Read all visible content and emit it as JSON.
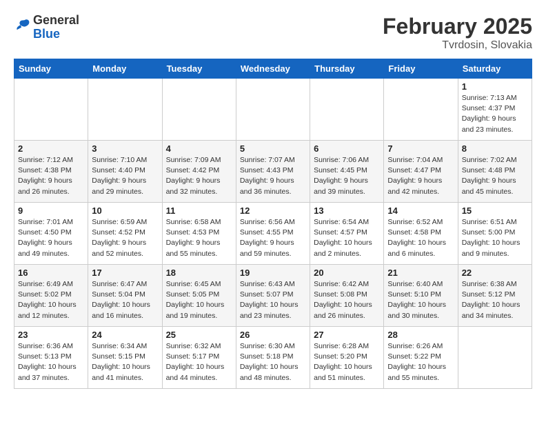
{
  "header": {
    "logo_general": "General",
    "logo_blue": "Blue",
    "month_title": "February 2025",
    "location": "Tvrdosin, Slovakia"
  },
  "days_of_week": [
    "Sunday",
    "Monday",
    "Tuesday",
    "Wednesday",
    "Thursday",
    "Friday",
    "Saturday"
  ],
  "weeks": [
    [
      {
        "day": "",
        "info": ""
      },
      {
        "day": "",
        "info": ""
      },
      {
        "day": "",
        "info": ""
      },
      {
        "day": "",
        "info": ""
      },
      {
        "day": "",
        "info": ""
      },
      {
        "day": "",
        "info": ""
      },
      {
        "day": "1",
        "info": "Sunrise: 7:13 AM\nSunset: 4:37 PM\nDaylight: 9 hours and 23 minutes."
      }
    ],
    [
      {
        "day": "2",
        "info": "Sunrise: 7:12 AM\nSunset: 4:38 PM\nDaylight: 9 hours and 26 minutes."
      },
      {
        "day": "3",
        "info": "Sunrise: 7:10 AM\nSunset: 4:40 PM\nDaylight: 9 hours and 29 minutes."
      },
      {
        "day": "4",
        "info": "Sunrise: 7:09 AM\nSunset: 4:42 PM\nDaylight: 9 hours and 32 minutes."
      },
      {
        "day": "5",
        "info": "Sunrise: 7:07 AM\nSunset: 4:43 PM\nDaylight: 9 hours and 36 minutes."
      },
      {
        "day": "6",
        "info": "Sunrise: 7:06 AM\nSunset: 4:45 PM\nDaylight: 9 hours and 39 minutes."
      },
      {
        "day": "7",
        "info": "Sunrise: 7:04 AM\nSunset: 4:47 PM\nDaylight: 9 hours and 42 minutes."
      },
      {
        "day": "8",
        "info": "Sunrise: 7:02 AM\nSunset: 4:48 PM\nDaylight: 9 hours and 45 minutes."
      }
    ],
    [
      {
        "day": "9",
        "info": "Sunrise: 7:01 AM\nSunset: 4:50 PM\nDaylight: 9 hours and 49 minutes."
      },
      {
        "day": "10",
        "info": "Sunrise: 6:59 AM\nSunset: 4:52 PM\nDaylight: 9 hours and 52 minutes."
      },
      {
        "day": "11",
        "info": "Sunrise: 6:58 AM\nSunset: 4:53 PM\nDaylight: 9 hours and 55 minutes."
      },
      {
        "day": "12",
        "info": "Sunrise: 6:56 AM\nSunset: 4:55 PM\nDaylight: 9 hours and 59 minutes."
      },
      {
        "day": "13",
        "info": "Sunrise: 6:54 AM\nSunset: 4:57 PM\nDaylight: 10 hours and 2 minutes."
      },
      {
        "day": "14",
        "info": "Sunrise: 6:52 AM\nSunset: 4:58 PM\nDaylight: 10 hours and 6 minutes."
      },
      {
        "day": "15",
        "info": "Sunrise: 6:51 AM\nSunset: 5:00 PM\nDaylight: 10 hours and 9 minutes."
      }
    ],
    [
      {
        "day": "16",
        "info": "Sunrise: 6:49 AM\nSunset: 5:02 PM\nDaylight: 10 hours and 12 minutes."
      },
      {
        "day": "17",
        "info": "Sunrise: 6:47 AM\nSunset: 5:04 PM\nDaylight: 10 hours and 16 minutes."
      },
      {
        "day": "18",
        "info": "Sunrise: 6:45 AM\nSunset: 5:05 PM\nDaylight: 10 hours and 19 minutes."
      },
      {
        "day": "19",
        "info": "Sunrise: 6:43 AM\nSunset: 5:07 PM\nDaylight: 10 hours and 23 minutes."
      },
      {
        "day": "20",
        "info": "Sunrise: 6:42 AM\nSunset: 5:08 PM\nDaylight: 10 hours and 26 minutes."
      },
      {
        "day": "21",
        "info": "Sunrise: 6:40 AM\nSunset: 5:10 PM\nDaylight: 10 hours and 30 minutes."
      },
      {
        "day": "22",
        "info": "Sunrise: 6:38 AM\nSunset: 5:12 PM\nDaylight: 10 hours and 34 minutes."
      }
    ],
    [
      {
        "day": "23",
        "info": "Sunrise: 6:36 AM\nSunset: 5:13 PM\nDaylight: 10 hours and 37 minutes."
      },
      {
        "day": "24",
        "info": "Sunrise: 6:34 AM\nSunset: 5:15 PM\nDaylight: 10 hours and 41 minutes."
      },
      {
        "day": "25",
        "info": "Sunrise: 6:32 AM\nSunset: 5:17 PM\nDaylight: 10 hours and 44 minutes."
      },
      {
        "day": "26",
        "info": "Sunrise: 6:30 AM\nSunset: 5:18 PM\nDaylight: 10 hours and 48 minutes."
      },
      {
        "day": "27",
        "info": "Sunrise: 6:28 AM\nSunset: 5:20 PM\nDaylight: 10 hours and 51 minutes."
      },
      {
        "day": "28",
        "info": "Sunrise: 6:26 AM\nSunset: 5:22 PM\nDaylight: 10 hours and 55 minutes."
      },
      {
        "day": "",
        "info": ""
      }
    ]
  ]
}
